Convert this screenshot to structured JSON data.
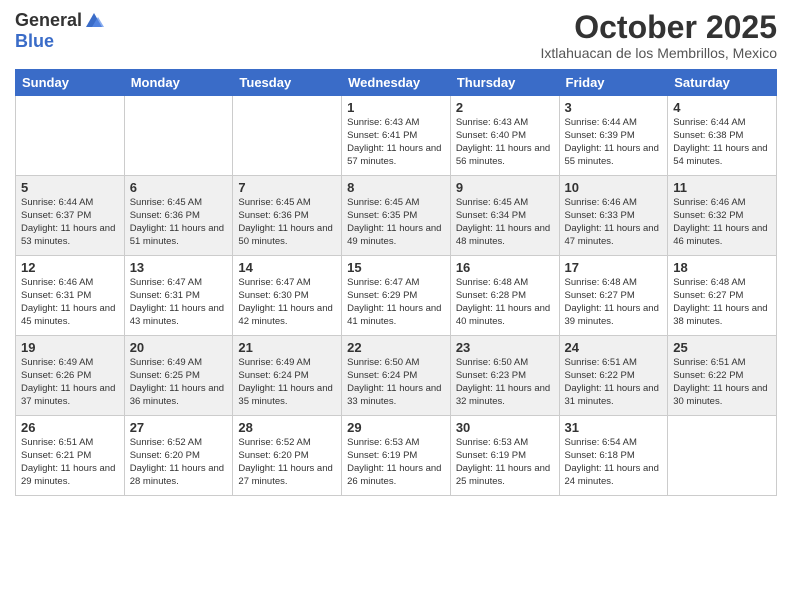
{
  "header": {
    "logo_general": "General",
    "logo_blue": "Blue",
    "month_title": "October 2025",
    "location": "Ixtlahuacan de los Membrillos, Mexico"
  },
  "days_of_week": [
    "Sunday",
    "Monday",
    "Tuesday",
    "Wednesday",
    "Thursday",
    "Friday",
    "Saturday"
  ],
  "weeks": [
    [
      {
        "day": "",
        "info": ""
      },
      {
        "day": "",
        "info": ""
      },
      {
        "day": "",
        "info": ""
      },
      {
        "day": "1",
        "info": "Sunrise: 6:43 AM\nSunset: 6:41 PM\nDaylight: 11 hours and 57 minutes."
      },
      {
        "day": "2",
        "info": "Sunrise: 6:43 AM\nSunset: 6:40 PM\nDaylight: 11 hours and 56 minutes."
      },
      {
        "day": "3",
        "info": "Sunrise: 6:44 AM\nSunset: 6:39 PM\nDaylight: 11 hours and 55 minutes."
      },
      {
        "day": "4",
        "info": "Sunrise: 6:44 AM\nSunset: 6:38 PM\nDaylight: 11 hours and 54 minutes."
      }
    ],
    [
      {
        "day": "5",
        "info": "Sunrise: 6:44 AM\nSunset: 6:37 PM\nDaylight: 11 hours and 53 minutes."
      },
      {
        "day": "6",
        "info": "Sunrise: 6:45 AM\nSunset: 6:36 PM\nDaylight: 11 hours and 51 minutes."
      },
      {
        "day": "7",
        "info": "Sunrise: 6:45 AM\nSunset: 6:36 PM\nDaylight: 11 hours and 50 minutes."
      },
      {
        "day": "8",
        "info": "Sunrise: 6:45 AM\nSunset: 6:35 PM\nDaylight: 11 hours and 49 minutes."
      },
      {
        "day": "9",
        "info": "Sunrise: 6:45 AM\nSunset: 6:34 PM\nDaylight: 11 hours and 48 minutes."
      },
      {
        "day": "10",
        "info": "Sunrise: 6:46 AM\nSunset: 6:33 PM\nDaylight: 11 hours and 47 minutes."
      },
      {
        "day": "11",
        "info": "Sunrise: 6:46 AM\nSunset: 6:32 PM\nDaylight: 11 hours and 46 minutes."
      }
    ],
    [
      {
        "day": "12",
        "info": "Sunrise: 6:46 AM\nSunset: 6:31 PM\nDaylight: 11 hours and 45 minutes."
      },
      {
        "day": "13",
        "info": "Sunrise: 6:47 AM\nSunset: 6:31 PM\nDaylight: 11 hours and 43 minutes."
      },
      {
        "day": "14",
        "info": "Sunrise: 6:47 AM\nSunset: 6:30 PM\nDaylight: 11 hours and 42 minutes."
      },
      {
        "day": "15",
        "info": "Sunrise: 6:47 AM\nSunset: 6:29 PM\nDaylight: 11 hours and 41 minutes."
      },
      {
        "day": "16",
        "info": "Sunrise: 6:48 AM\nSunset: 6:28 PM\nDaylight: 11 hours and 40 minutes."
      },
      {
        "day": "17",
        "info": "Sunrise: 6:48 AM\nSunset: 6:27 PM\nDaylight: 11 hours and 39 minutes."
      },
      {
        "day": "18",
        "info": "Sunrise: 6:48 AM\nSunset: 6:27 PM\nDaylight: 11 hours and 38 minutes."
      }
    ],
    [
      {
        "day": "19",
        "info": "Sunrise: 6:49 AM\nSunset: 6:26 PM\nDaylight: 11 hours and 37 minutes."
      },
      {
        "day": "20",
        "info": "Sunrise: 6:49 AM\nSunset: 6:25 PM\nDaylight: 11 hours and 36 minutes."
      },
      {
        "day": "21",
        "info": "Sunrise: 6:49 AM\nSunset: 6:24 PM\nDaylight: 11 hours and 35 minutes."
      },
      {
        "day": "22",
        "info": "Sunrise: 6:50 AM\nSunset: 6:24 PM\nDaylight: 11 hours and 33 minutes."
      },
      {
        "day": "23",
        "info": "Sunrise: 6:50 AM\nSunset: 6:23 PM\nDaylight: 11 hours and 32 minutes."
      },
      {
        "day": "24",
        "info": "Sunrise: 6:51 AM\nSunset: 6:22 PM\nDaylight: 11 hours and 31 minutes."
      },
      {
        "day": "25",
        "info": "Sunrise: 6:51 AM\nSunset: 6:22 PM\nDaylight: 11 hours and 30 minutes."
      }
    ],
    [
      {
        "day": "26",
        "info": "Sunrise: 6:51 AM\nSunset: 6:21 PM\nDaylight: 11 hours and 29 minutes."
      },
      {
        "day": "27",
        "info": "Sunrise: 6:52 AM\nSunset: 6:20 PM\nDaylight: 11 hours and 28 minutes."
      },
      {
        "day": "28",
        "info": "Sunrise: 6:52 AM\nSunset: 6:20 PM\nDaylight: 11 hours and 27 minutes."
      },
      {
        "day": "29",
        "info": "Sunrise: 6:53 AM\nSunset: 6:19 PM\nDaylight: 11 hours and 26 minutes."
      },
      {
        "day": "30",
        "info": "Sunrise: 6:53 AM\nSunset: 6:19 PM\nDaylight: 11 hours and 25 minutes."
      },
      {
        "day": "31",
        "info": "Sunrise: 6:54 AM\nSunset: 6:18 PM\nDaylight: 11 hours and 24 minutes."
      },
      {
        "day": "",
        "info": ""
      }
    ]
  ]
}
